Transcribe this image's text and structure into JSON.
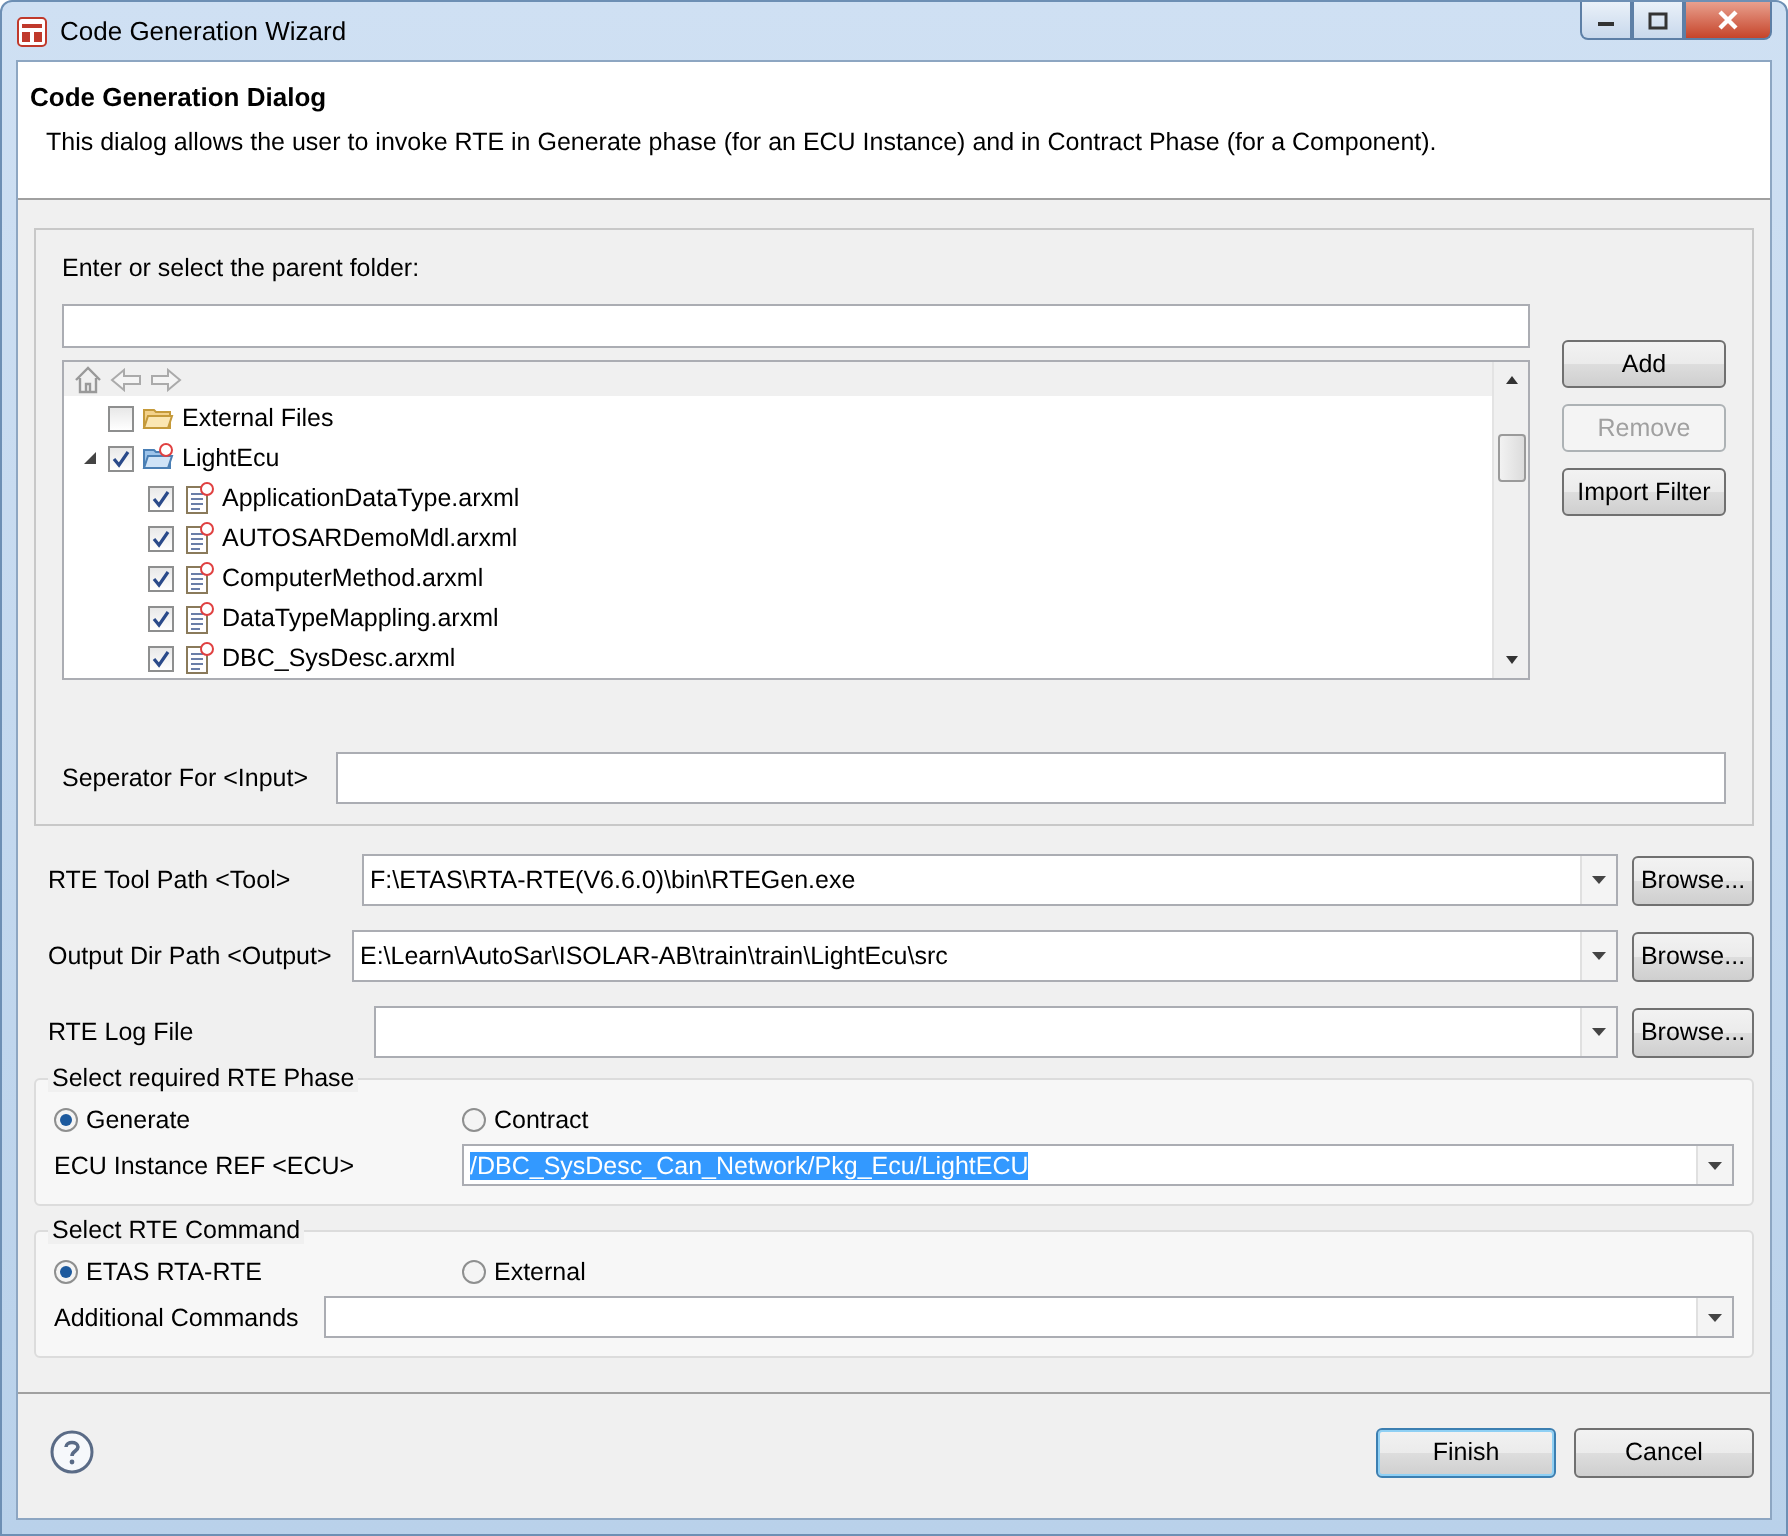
{
  "window": {
    "title": "Code Generation Wizard"
  },
  "header": {
    "title": "Code Generation Dialog",
    "description": "This dialog allows the user to invoke RTE in Generate phase (for an ECU Instance) and in Contract Phase (for a Component)."
  },
  "folder_group": {
    "label": "Enter or select the parent folder:",
    "tree": [
      {
        "label": "External Files",
        "kind": "folder",
        "checked": false
      },
      {
        "label": "LightEcu",
        "kind": "project",
        "checked": true,
        "expanded": true,
        "children": [
          {
            "label": "ApplicationDataType.arxml",
            "kind": "file",
            "checked": true
          },
          {
            "label": "AUTOSARDemoMdl.arxml",
            "kind": "file",
            "checked": true
          },
          {
            "label": "ComputerMethod.arxml",
            "kind": "file",
            "checked": true
          },
          {
            "label": "DataTypeMappling.arxml",
            "kind": "file",
            "checked": true
          },
          {
            "label": "DBC_SysDesc.arxml",
            "kind": "file",
            "checked": true
          }
        ]
      }
    ],
    "buttons": [
      {
        "label": "Add",
        "disabled": false
      },
      {
        "label": "Remove",
        "disabled": true
      },
      {
        "label": "Import Filter",
        "disabled": false
      }
    ],
    "separator_label": "Seperator For <Input>"
  },
  "paths": [
    {
      "label": "RTE Tool Path <Tool>",
      "value": "F:\\ETAS\\RTA-RTE(V6.6.0)\\bin\\RTEGen.exe",
      "button": "Browse..."
    },
    {
      "label": "Output Dir Path <Output>",
      "value": "E:\\Learn\\AutoSar\\ISOLAR-AB\\train\\train\\LightEcu\\src",
      "button": "Browse..."
    },
    {
      "label": "RTE Log File",
      "button": "Browse..."
    }
  ],
  "phase_group": {
    "title": "Select required RTE Phase",
    "options": [
      {
        "label": "Generate",
        "selected": true
      },
      {
        "label": "Contract",
        "selected": false
      }
    ],
    "field": {
      "label": "ECU Instance REF <ECU>",
      "value": "/DBC_SysDesc_Can_Network/Pkg_Ecu/LightECU",
      "text_selected": true
    }
  },
  "command_group": {
    "title": "Select RTE Command",
    "options": [
      {
        "label": "ETAS RTA-RTE",
        "selected": true
      },
      {
        "label": "External",
        "selected": false
      }
    ],
    "field": {
      "label": "Additional Commands"
    }
  },
  "footer": {
    "buttons": [
      {
        "label": "Finish",
        "default": true
      },
      {
        "label": "Cancel",
        "default": false
      }
    ]
  }
}
